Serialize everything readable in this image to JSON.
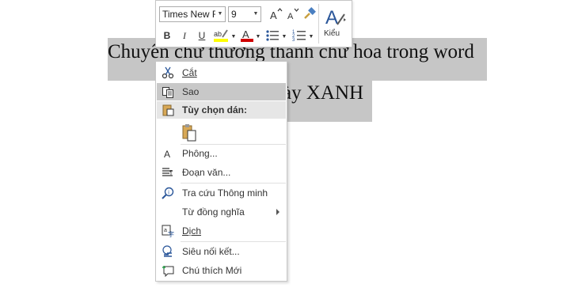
{
  "document": {
    "line1": "Chuyển chữ thường thành chữ hoa trong word",
    "line2": "ày XANH"
  },
  "mini_toolbar": {
    "font_name": "Times New Ro",
    "font_size": "9",
    "bold": "B",
    "italic": "I",
    "underline": "U",
    "styles_label": "Kiểu",
    "highlight_color": "#ffff00",
    "font_color": "#d00000",
    "accent_color": "#2b579a"
  },
  "context_menu": {
    "items": [
      {
        "label": "Cắt",
        "icon": "scissors-icon"
      },
      {
        "label": "Sao",
        "icon": "copy-icon"
      },
      {
        "label": "Tùy chọn dán:",
        "icon": "paste-icon"
      },
      {
        "label": "",
        "icon": "paste-keep-text-icon"
      },
      {
        "label": "Phông...",
        "icon": "font-icon"
      },
      {
        "label": "Đoạn văn...",
        "icon": "paragraph-icon"
      },
      {
        "label": "Tra cứu Thông minh",
        "icon": "smart-lookup-icon"
      },
      {
        "label": "Từ đồng nghĩa",
        "icon": ""
      },
      {
        "label": "Dịch",
        "icon": "translate-icon"
      },
      {
        "label": "Siêu nối kết...",
        "icon": "hyperlink-icon"
      },
      {
        "label": "Chú thích Mới",
        "icon": "new-comment-icon"
      }
    ]
  }
}
